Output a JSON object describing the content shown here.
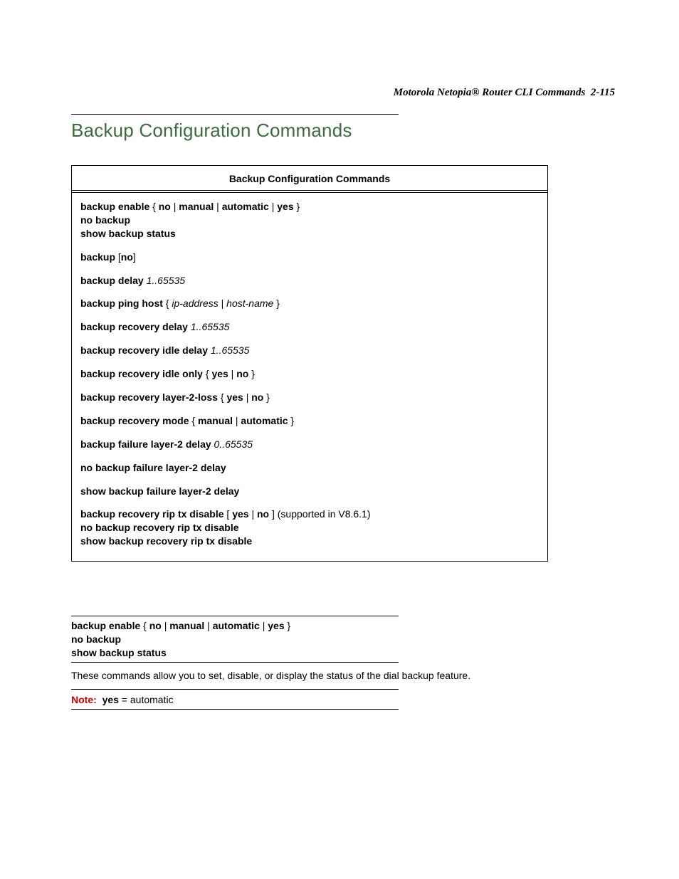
{
  "header": {
    "doc_title": "Motorola Netopia® Router CLI Commands",
    "page_ref": "2-115"
  },
  "section": {
    "title": "Backup Configuration Commands"
  },
  "box": {
    "title": "Backup Configuration Commands",
    "l1a": "backup enable",
    "l1b": " { ",
    "l1c": "no",
    "l1d": " | ",
    "l1e": "manual",
    "l1f": " | ",
    "l1g": "automatic",
    "l1h": " | ",
    "l1i": "yes",
    "l1j": " }",
    "l2": "no backup",
    "l3": "show backup status",
    "l4a": "backup",
    "l4b": " [",
    "l4c": "no",
    "l4d": "]",
    "l5a": "backup delay",
    "l5b": " 1..65535",
    "l6a": "backup ping host",
    "l6b": " { ",
    "l6c": "ip-address",
    "l6d": " | ",
    "l6e": "host-name",
    "l6f": " }",
    "l7a": "backup recovery delay",
    "l7b": " 1..65535",
    "l8a": "backup recovery idle delay ",
    "l8b": " 1..65535",
    "l9a": "backup recovery idle only",
    "l9b": " { ",
    "l9c": "yes",
    "l9d": " | ",
    "l9e": "no",
    "l9f": " }",
    "l10a": "backup recovery layer-2-loss",
    "l10b": " { ",
    "l10c": "yes",
    "l10d": " | ",
    "l10e": "no",
    "l10f": " }",
    "l11a": "backup recovery mode",
    "l11b": " { ",
    "l11c": "manual",
    "l11d": " | ",
    "l11e": "automatic",
    "l11f": " }",
    "l12a": "backup failure layer-2 delay",
    "l12b": " 0..65535",
    "l13": "no backup failure layer-2 delay",
    "l14": "show backup failure layer-2 delay",
    "l15a": "backup recovery rip tx disable",
    "l15b": " [ ",
    "l15c": "yes",
    "l15d": " | ",
    "l15e": "no",
    "l15f": " ]  ",
    "l15g": "(supported in V8.6.1)",
    "l16": "no backup recovery rip tx disable",
    "l17": "show backup recovery rip tx disable"
  },
  "detail": {
    "d1a": "backup enable",
    "d1b": " { ",
    "d1c": "no",
    "d1d": " | ",
    "d1e": "manual",
    "d1f": " | ",
    "d1g": "automatic",
    "d1h": " | ",
    "d1i": "yes",
    "d1j": " }",
    "d2": "no backup",
    "d3": "show backup status",
    "desc": "These commands allow you to set, disable, or display the status of the dial backup feature.",
    "note_label": "Note:",
    "note_b": "yes",
    "note_rest": " = automatic"
  }
}
